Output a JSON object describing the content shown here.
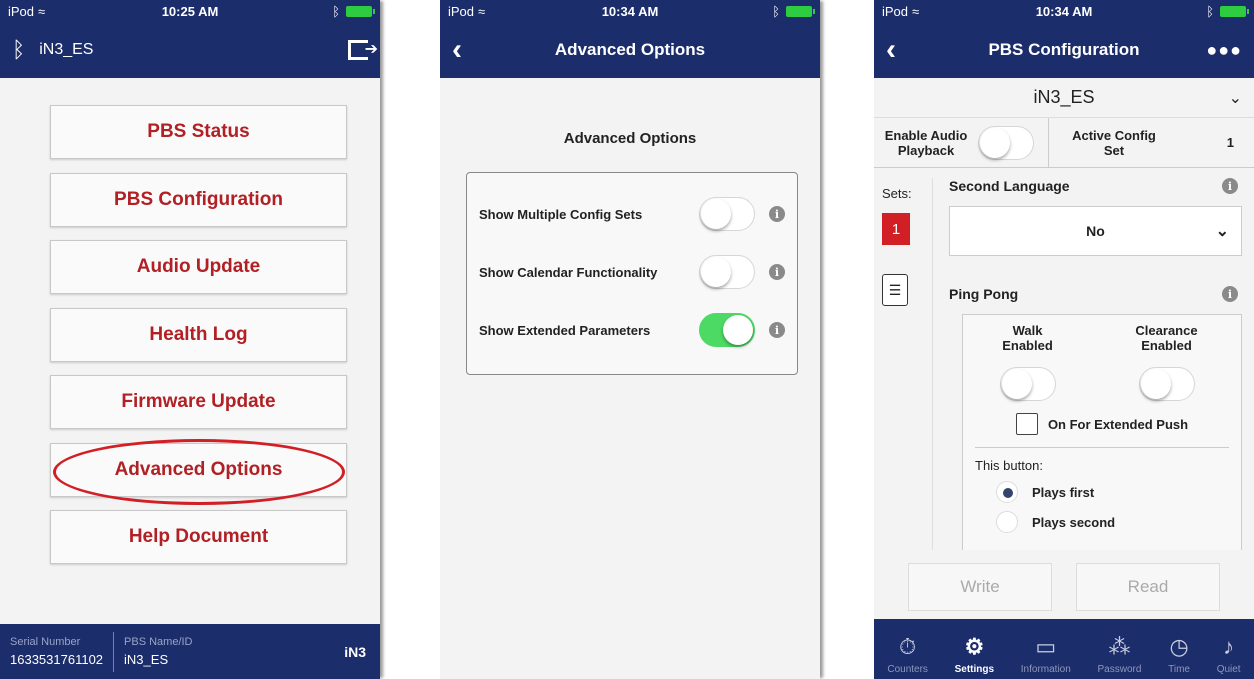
{
  "status": {
    "carrier": "iPod",
    "time1": "10:25 AM",
    "time2": "10:34 AM",
    "time3": "10:34 AM"
  },
  "screen1": {
    "device_name": "iN3_ES",
    "menu": [
      "PBS Status",
      "PBS Configuration",
      "Audio Update",
      "Health Log",
      "Firmware Update",
      "Advanced Options",
      "Help Document"
    ],
    "footer": {
      "serial_label": "Serial Number",
      "serial_value": "1633531761102",
      "pbs_label": "PBS Name/ID",
      "pbs_value": "iN3_ES",
      "model": "iN3"
    }
  },
  "screen2": {
    "title": "Advanced Options",
    "heading": "Advanced Options",
    "options": [
      {
        "label": "Show Multiple Config Sets",
        "on": false
      },
      {
        "label": "Show Calendar Functionality",
        "on": false
      },
      {
        "label": "Show Extended Parameters",
        "on": true
      }
    ],
    "info_glyph": "i"
  },
  "screen3": {
    "title": "PBS Configuration",
    "more_glyph": "●●●",
    "device": "iN3_ES",
    "enable_audio_label": "Enable Audio Playback",
    "enable_audio_on": false,
    "active_config_label": "Active Config Set",
    "active_config_value": "1",
    "sets_label": "Sets:",
    "set_selected": "1",
    "second_language_label": "Second Language",
    "second_language_value": "No",
    "ping_pong_label": "Ping Pong",
    "walk_enabled_label": "Walk Enabled",
    "clearance_enabled_label": "Clearance Enabled",
    "extended_push_label": "On For Extended Push",
    "this_button_label": "This button:",
    "radio_options": [
      {
        "label": "Plays first",
        "selected": true
      },
      {
        "label": "Plays second",
        "selected": false
      }
    ],
    "write_label": "Write",
    "read_label": "Read",
    "tabs": [
      {
        "label": "Counters",
        "icon": "stopwatch-icon",
        "glyph": "⏱",
        "active": false
      },
      {
        "label": "Settings",
        "icon": "sliders-icon",
        "glyph": "⚙",
        "active": true
      },
      {
        "label": "Information",
        "icon": "terminal-icon",
        "glyph": "▭",
        "active": false
      },
      {
        "label": "Password",
        "icon": "password-icon",
        "glyph": "⁂",
        "active": false
      },
      {
        "label": "Time",
        "icon": "clock-icon",
        "glyph": "◷",
        "active": false
      },
      {
        "label": "Quiet",
        "icon": "quiet-icon",
        "glyph": "♪",
        "active": false
      }
    ]
  },
  "colors": {
    "navy": "#1c2d6b",
    "brand_red": "#b12024",
    "toggle_green": "#4cd964"
  }
}
